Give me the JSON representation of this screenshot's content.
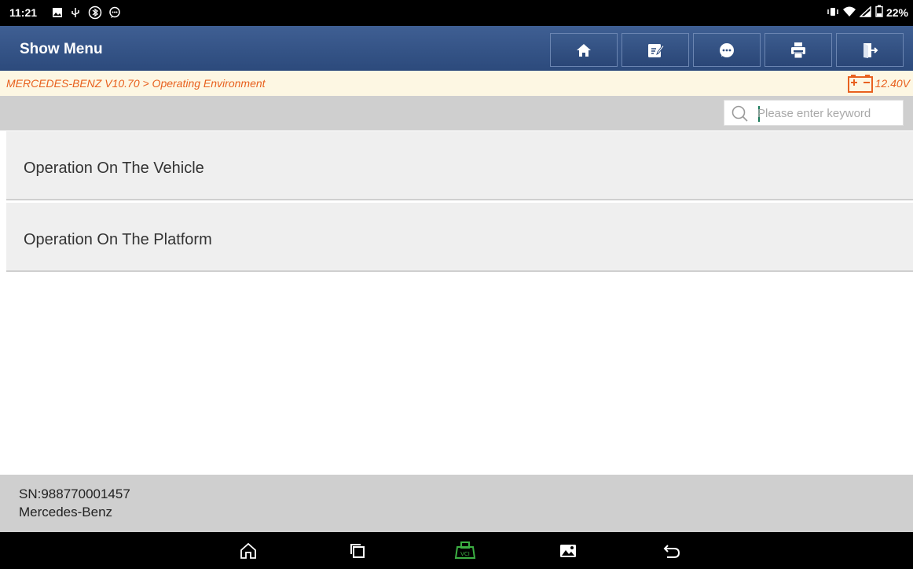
{
  "status_bar": {
    "time": "11:21",
    "battery": "22%",
    "icons": [
      "image-icon",
      "usb-icon",
      "bluetooth-icon",
      "chat-icon",
      "vibrate-icon",
      "wifi-icon",
      "signal-icon",
      "battery-icon"
    ]
  },
  "header": {
    "title": "Show Menu",
    "buttons": [
      {
        "icon": "home-icon"
      },
      {
        "icon": "edit-icon"
      },
      {
        "icon": "message-icon"
      },
      {
        "icon": "print-icon"
      },
      {
        "icon": "exit-icon"
      }
    ],
    "color": "#2f4e80"
  },
  "breadcrumb": {
    "path": "MERCEDES-BENZ V10.70 > Operating Environment",
    "voltage": "12.40V",
    "accent_color": "#e8611f"
  },
  "search": {
    "placeholder": "Please enter keyword",
    "value": ""
  },
  "menu": {
    "items": [
      {
        "label": "Operation On The Vehicle"
      },
      {
        "label": "Operation On The Platform"
      }
    ]
  },
  "footer": {
    "sn": "SN:988770001457",
    "brand": "Mercedes-Benz"
  },
  "nav_bar": {
    "buttons": [
      "home-icon",
      "recents-icon",
      "vci-icon",
      "screenshot-icon",
      "back-icon"
    ],
    "vci_color": "#3cb043"
  }
}
